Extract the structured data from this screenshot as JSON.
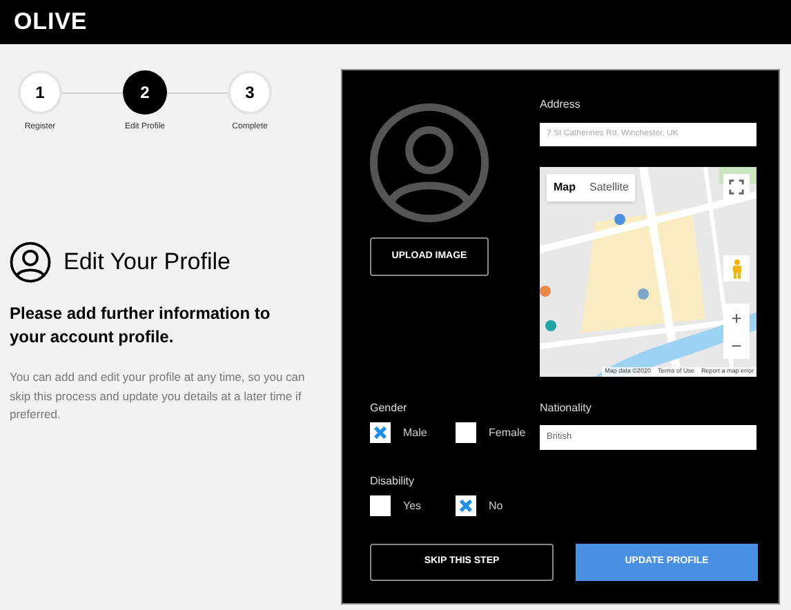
{
  "header": {
    "logo": "OLIVE"
  },
  "steps": [
    {
      "number": "1",
      "label": "Register",
      "selected": false
    },
    {
      "number": "2",
      "label": "Edit Profile",
      "selected": true
    },
    {
      "number": "3",
      "label": "Complete",
      "selected": false
    }
  ],
  "intro": {
    "title": "Edit Your Profile",
    "subtitle": "Please add further information to your account profile.",
    "body": "You can add and edit your profile at any time, so you can skip this process and update you details at a later time if preferred."
  },
  "form": {
    "upload_button": "UPLOAD IMAGE",
    "address": {
      "label": "Address",
      "placeholder": "7 St Catherines Rd, Winchester, UK"
    },
    "map": {
      "tabs": [
        {
          "label": "Map",
          "selected": true
        },
        {
          "label": "Satellite",
          "selected": false
        }
      ],
      "zoom_in": "+",
      "zoom_out": "−",
      "footer": [
        "Map data ©2020",
        "Terms of Use",
        "Report a map error"
      ]
    },
    "gender": {
      "label": "Gender",
      "options": [
        {
          "label": "Male",
          "checked": true
        },
        {
          "label": "Female",
          "checked": false
        }
      ]
    },
    "nationality": {
      "label": "Nationality",
      "value": "British"
    },
    "disability": {
      "label": "Disability",
      "options": [
        {
          "label": "Yes",
          "checked": false
        },
        {
          "label": "No",
          "checked": true
        }
      ]
    },
    "buttons": [
      {
        "kind": "secondary",
        "label": "SKIP THIS STEP"
      },
      {
        "kind": "primary",
        "label": "UPDATE PROFILE"
      }
    ]
  }
}
